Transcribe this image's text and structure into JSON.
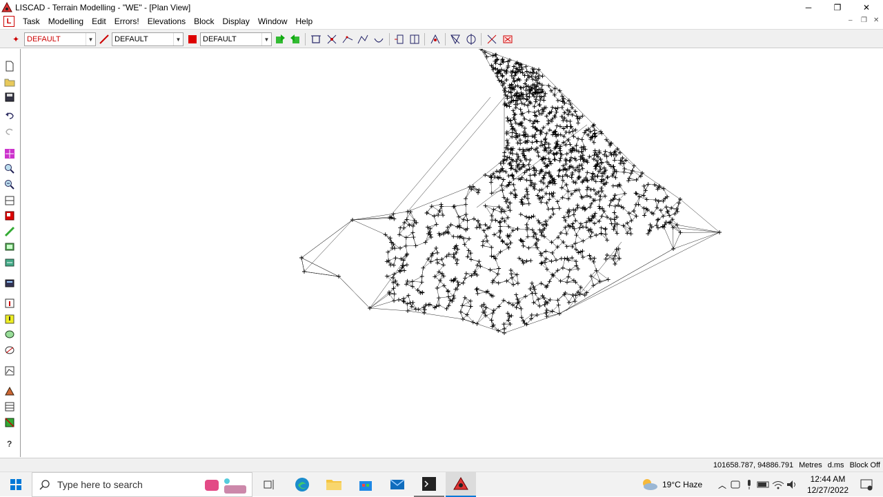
{
  "window": {
    "title": "LISCAD - Terrain Modelling - \"WE\" - [Plan View]",
    "minimize": "─",
    "maximize": "❐",
    "close": "✕"
  },
  "menubar": {
    "doc_icon": "L",
    "items": [
      "Task",
      "Modelling",
      "Edit",
      "Errors!",
      "Elevations",
      "Block",
      "Display",
      "Window",
      "Help"
    ],
    "mdi_min": "–",
    "mdi_restore": "❐",
    "mdi_close": "✕"
  },
  "toolbar": {
    "combo1": "DEFAULT",
    "combo2": "DEFAULT",
    "combo3": "DEFAULT"
  },
  "status": {
    "coords": "101658.787, 94886.791",
    "units": "Metres",
    "angle": "d.ms",
    "block": "Block Off"
  },
  "taskbar": {
    "search_placeholder": "Type here to search",
    "weather": "19°C  Haze",
    "time": "12:44 AM",
    "date": "12/27/2022"
  },
  "colors": {
    "accent_red": "#cc0000",
    "taskbar_bg": "#f2f2f2"
  }
}
